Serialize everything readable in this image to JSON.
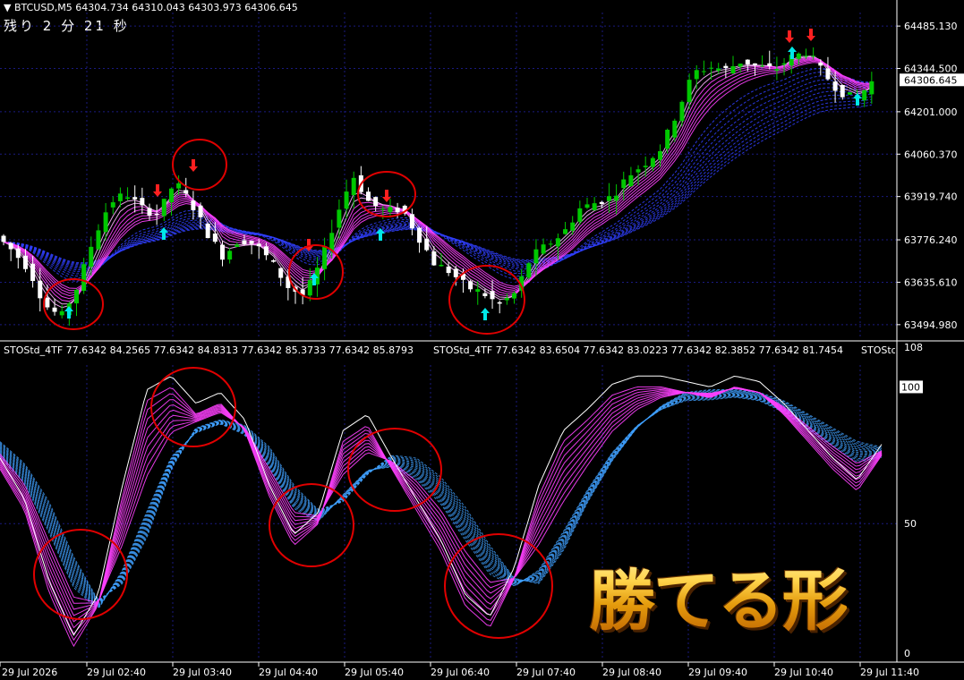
{
  "header": {
    "symbol": "BTCUSD,M5",
    "ohlc": "64304.734 64310.043 64303.973 64306.645",
    "timer": "残り 2 分 21 秒"
  },
  "indicator": {
    "label_left": "STOStd_4TF 77.6342 84.2565 77.6342 84.8313 77.6342 85.3733 77.6342 85.8793",
    "label_right": "STOStd_4TF 77.6342 83.6504 77.6342 83.0223 77.6342 82.3852 77.6342 81.7454",
    "label_cut": "STOStd"
  },
  "banner_text": "勝てる形",
  "colors": {
    "bull": "#00c800",
    "bear": "#ffffff",
    "ma_fast": "#ff40ff",
    "ma_slow": "#3040ff",
    "osc_fast": "#ff40ff",
    "osc_slow": "#40a0ff",
    "circle": "#e00000",
    "grid": "#1a1a80"
  },
  "chart_data": [
    {
      "type": "candlestick",
      "title": "BTCUSD,M5",
      "y_ticks": [
        "64485.130",
        "64344.500",
        "64201.000",
        "64060.370",
        "63919.740",
        "63776.240",
        "63635.610",
        "63494.980"
      ],
      "current_price": "64306.645",
      "ylim": [
        63450,
        64530
      ],
      "x_ticks": [
        "29 Jul 2026",
        "29 Jul 02:40",
        "29 Jul 03:40",
        "29 Jul 04:40",
        "29 Jul 05:40",
        "29 Jul 06:40",
        "29 Jul 07:40",
        "29 Jul 08:40",
        "29 Jul 09:40",
        "29 Jul 10:40",
        "29 Jul 11:40"
      ],
      "close_path": [
        63790,
        63740,
        63680,
        63560,
        63520,
        63620,
        63780,
        63900,
        63930,
        63880,
        63860,
        63970,
        63900,
        63800,
        63720,
        63780,
        63760,
        63700,
        63620,
        63590,
        63700,
        63860,
        63990,
        63900,
        63870,
        63880,
        63790,
        63700,
        63670,
        63620,
        63600,
        63560,
        63600,
        63720,
        63760,
        63800,
        63880,
        63900,
        63920,
        63990,
        64030,
        64080,
        64200,
        64330,
        64350,
        64340,
        64370,
        64350,
        64340,
        64380,
        64400,
        64330,
        64270,
        64240,
        64300
      ],
      "buy_signals": 6,
      "sell_signals": 5
    },
    {
      "type": "line",
      "title": "STOStd_4TF",
      "y_ticks": [
        "108",
        "100",
        "50",
        "0"
      ],
      "ylim": [
        0,
        108
      ],
      "fast_path": [
        70,
        55,
        25,
        5,
        20,
        60,
        95,
        100,
        90,
        94,
        84,
        60,
        42,
        50,
        80,
        86,
        70,
        55,
        40,
        20,
        12,
        30,
        60,
        80,
        88,
        97,
        100,
        100,
        98,
        96,
        100,
        98,
        90,
        80,
        70,
        62,
        75
      ],
      "slow_path": [
        80,
        72,
        58,
        38,
        22,
        28,
        45,
        70,
        85,
        88,
        86,
        78,
        64,
        55,
        58,
        68,
        75,
        74,
        67,
        56,
        42,
        30,
        28,
        40,
        58,
        73,
        85,
        93,
        98,
        99,
        99,
        98,
        95,
        90,
        85,
        80,
        78
      ]
    }
  ]
}
